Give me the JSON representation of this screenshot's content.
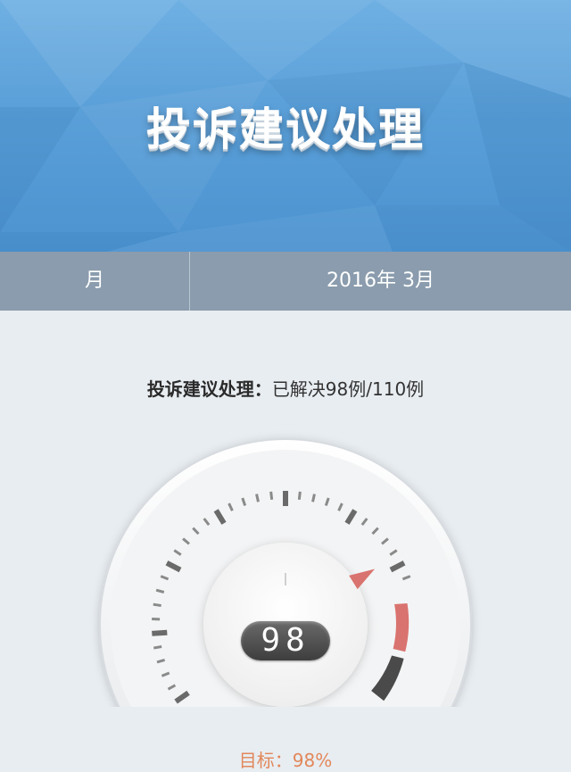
{
  "header": {
    "title": "投诉建议处理"
  },
  "period": {
    "label": "月",
    "value": "2016年 3月"
  },
  "summary": {
    "label": "投诉建议处理：",
    "text": "已解决98例/110例"
  },
  "gauge": {
    "value": 98,
    "display": "98",
    "resolved": 98,
    "total": 110
  },
  "target": {
    "text": "目标：98%"
  },
  "colors": {
    "banner": "#5a9fd8",
    "period_bar": "#8a9cad",
    "danger": "#d9736f",
    "target_text": "#e2875a"
  }
}
